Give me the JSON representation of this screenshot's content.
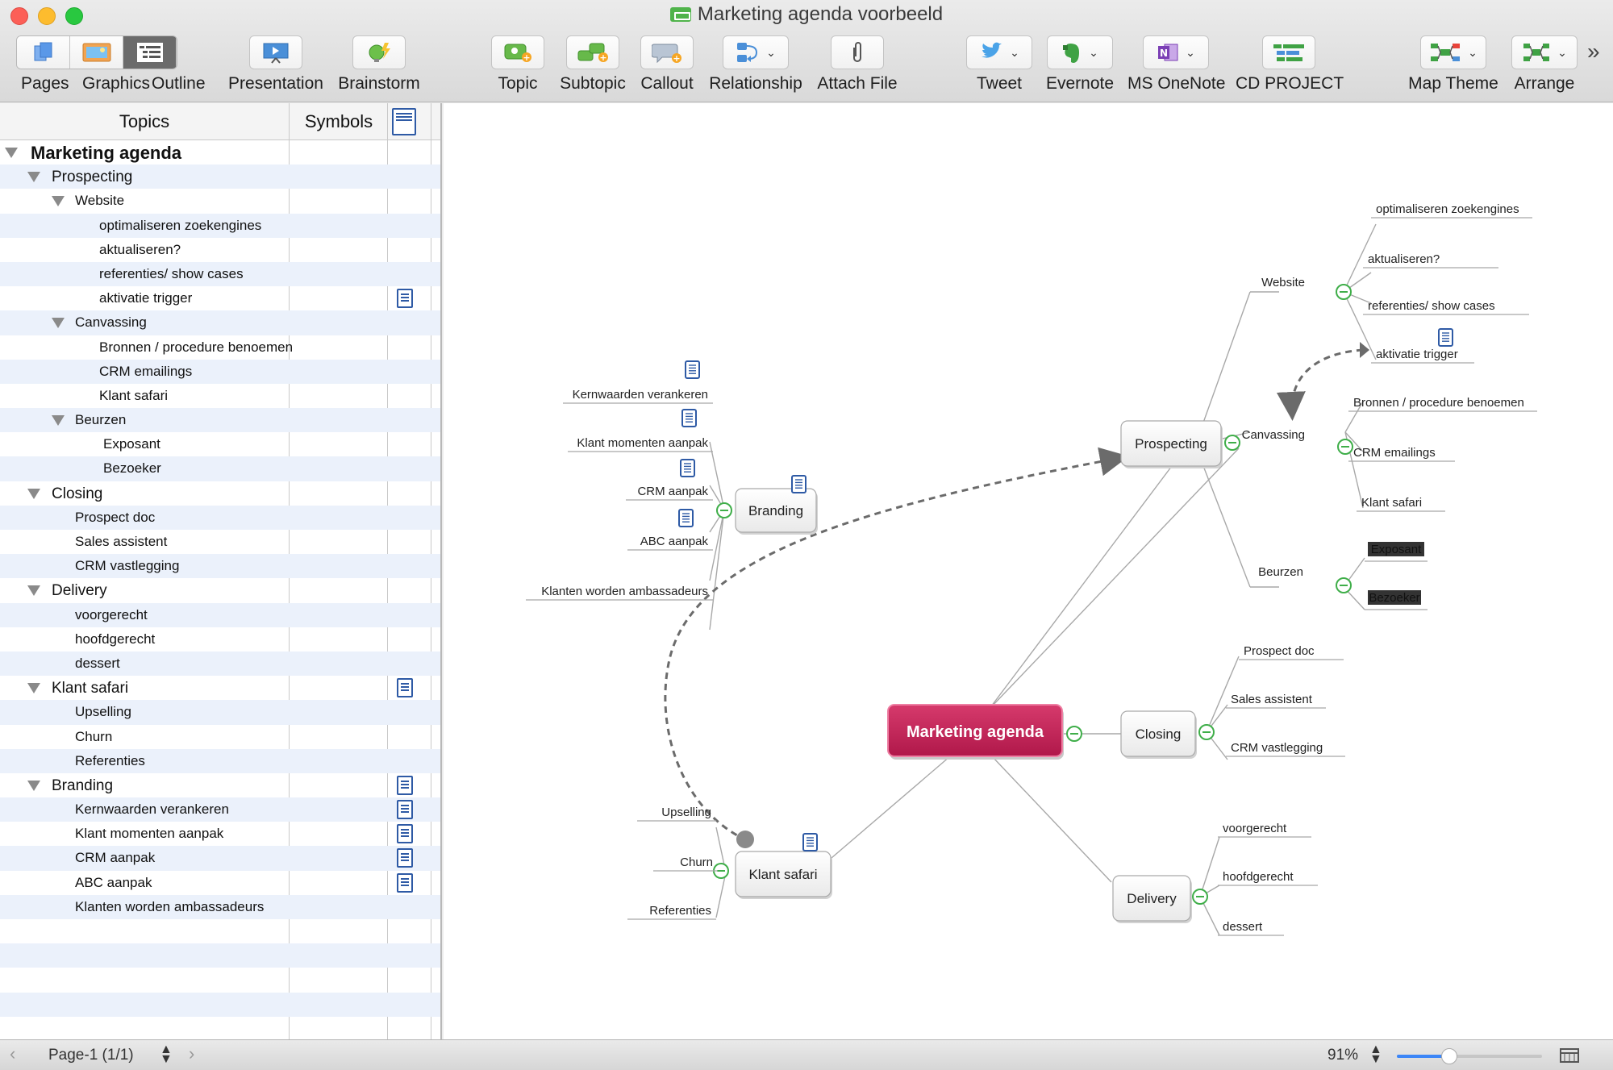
{
  "window": {
    "title": "Marketing agenda voorbeeld"
  },
  "toolbar": {
    "view_segments": [
      "Pages",
      "Graphics",
      "Outline"
    ],
    "items": [
      {
        "label": "Presentation",
        "icon": "presentation-icon"
      },
      {
        "label": "Brainstorm",
        "icon": "brainstorm-icon"
      },
      {
        "label": "Topic",
        "icon": "topic-icon"
      },
      {
        "label": "Subtopic",
        "icon": "subtopic-icon"
      },
      {
        "label": "Callout",
        "icon": "callout-icon"
      },
      {
        "label": "Relationship",
        "icon": "relationship-icon"
      },
      {
        "label": "Attach File",
        "icon": "paperclip-icon"
      },
      {
        "label": "Tweet",
        "icon": "twitter-icon"
      },
      {
        "label": "Evernote",
        "icon": "evernote-icon"
      },
      {
        "label": "MS OneNote",
        "icon": "onenote-icon"
      },
      {
        "label": "CD PROJECT",
        "icon": "project-icon"
      },
      {
        "label": "Map Theme",
        "icon": "map-theme-icon"
      },
      {
        "label": "Arrange",
        "icon": "arrange-icon"
      }
    ],
    "overflow": "»"
  },
  "outline": {
    "headers": {
      "topics": "Topics",
      "symbols": "Symbols"
    },
    "rows": [
      {
        "label": "Marketing agenda",
        "level": 0,
        "expanded": true,
        "note": false
      },
      {
        "label": "Prospecting",
        "level": 1,
        "expanded": true,
        "note": false
      },
      {
        "label": "Website",
        "level": 2,
        "expanded": true,
        "note": false
      },
      {
        "label": "optimaliseren zoekengines",
        "level": 3,
        "note": false
      },
      {
        "label": "aktualiseren?",
        "level": 3,
        "note": false
      },
      {
        "label": "referenties/ show cases",
        "level": 3,
        "note": false
      },
      {
        "label": "aktivatie trigger",
        "level": 3,
        "note": true
      },
      {
        "label": "Canvassing",
        "level": 2,
        "expanded": true,
        "note": false
      },
      {
        "label": "Bronnen / procedure benoemen",
        "level": 3,
        "note": false
      },
      {
        "label": "CRM emailings",
        "level": 3,
        "note": false
      },
      {
        "label": "Klant safari",
        "level": 3,
        "note": false
      },
      {
        "label": "Beurzen",
        "level": 2,
        "expanded": true,
        "note": false
      },
      {
        "label": "Exposant",
        "level": 3.2,
        "note": false
      },
      {
        "label": "Bezoeker",
        "level": 3.2,
        "note": false
      },
      {
        "label": "Closing",
        "level": 1,
        "expanded": true,
        "note": false
      },
      {
        "label": "Prospect doc",
        "level": 2.5,
        "note": false
      },
      {
        "label": "Sales assistent",
        "level": 2.5,
        "note": false
      },
      {
        "label": "CRM vastlegging",
        "level": 2.5,
        "note": false
      },
      {
        "label": "Delivery",
        "level": 1,
        "expanded": true,
        "note": false
      },
      {
        "label": "voorgerecht",
        "level": 2.5,
        "note": false
      },
      {
        "label": "hoofdgerecht",
        "level": 2.5,
        "note": false
      },
      {
        "label": "dessert",
        "level": 2.5,
        "note": false
      },
      {
        "label": "Klant safari",
        "level": 1,
        "expanded": true,
        "note": true
      },
      {
        "label": "Upselling",
        "level": 2.5,
        "note": false
      },
      {
        "label": "Churn",
        "level": 2.5,
        "note": false
      },
      {
        "label": "Referenties",
        "level": 2.5,
        "note": false
      },
      {
        "label": "Branding",
        "level": 1,
        "expanded": true,
        "note": true
      },
      {
        "label": "Kernwaarden verankeren",
        "level": 2.5,
        "note": true
      },
      {
        "label": "Klant momenten aanpak",
        "level": 2.5,
        "note": true
      },
      {
        "label": "CRM aanpak",
        "level": 2.5,
        "note": true
      },
      {
        "label": "ABC aanpak",
        "level": 2.5,
        "note": true
      },
      {
        "label": "Klanten worden ambassadeurs",
        "level": 2.5,
        "note": false
      }
    ]
  },
  "map": {
    "central": "Marketing agenda",
    "topics": {
      "prospecting": "Prospecting",
      "closing": "Closing",
      "delivery": "Delivery",
      "klant_safari": "Klant safari",
      "branding": "Branding"
    },
    "prospecting": {
      "website": "Website",
      "website_items": [
        "optimaliseren zoekengines",
        "aktualiseren?",
        "referenties/ show cases",
        "aktivatie trigger"
      ],
      "canvassing": "Canvassing",
      "canvassing_items": [
        "Bronnen / procedure benoemen",
        "CRM emailings",
        "Klant safari"
      ],
      "beurzen": "Beurzen",
      "beurzen_items": [
        "Exposant",
        "Bezoeker"
      ]
    },
    "closing_items": [
      "Prospect doc",
      "Sales assistent",
      "CRM vastlegging"
    ],
    "delivery_items": [
      "voorgerecht",
      "hoofdgerecht",
      "dessert"
    ],
    "klant_safari_items": [
      "Upselling",
      "Churn",
      "Referenties"
    ],
    "branding_items": [
      "Kernwaarden verankeren",
      "Klant momenten aanpak",
      "CRM aanpak",
      "ABC aanpak",
      "Klanten worden ambassadeurs"
    ],
    "colors": {
      "central": "#c8245a",
      "line": "#a8a8a8",
      "collapse": "#3fae49",
      "note": "#2e5aa5"
    }
  },
  "status": {
    "page": "Page-1 (1/1)",
    "zoom": "91%",
    "zoom_fraction": 0.36
  }
}
